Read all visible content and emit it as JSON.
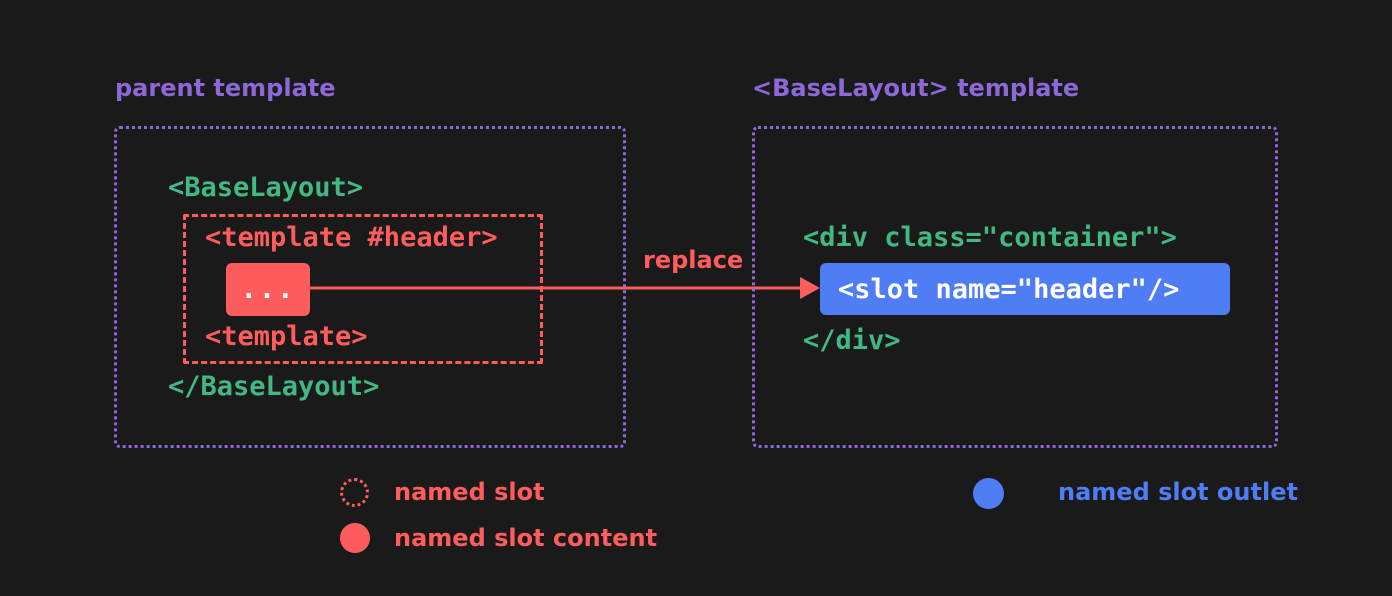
{
  "colors": {
    "background": "#1a1a1a",
    "purple": "#8e68d9",
    "green": "#42b883",
    "red": "#ff5d5d",
    "blue": "#4f7df6",
    "white": "#ffffff"
  },
  "parent": {
    "title": "parent template",
    "open_tag": "<BaseLayout>",
    "template_open": "<template #header>",
    "content": "...",
    "template_close": "<template>",
    "close_tag": "</BaseLayout>"
  },
  "arrow": {
    "label": "replace"
  },
  "child": {
    "title": "<BaseLayout> template",
    "div_open": "<div class=\"container\">",
    "slot": "<slot name=\"header\"/>",
    "div_close": "</div>"
  },
  "legend": {
    "named_slot": "named slot",
    "named_slot_content": "named slot content",
    "named_slot_outlet": "named slot outlet"
  }
}
